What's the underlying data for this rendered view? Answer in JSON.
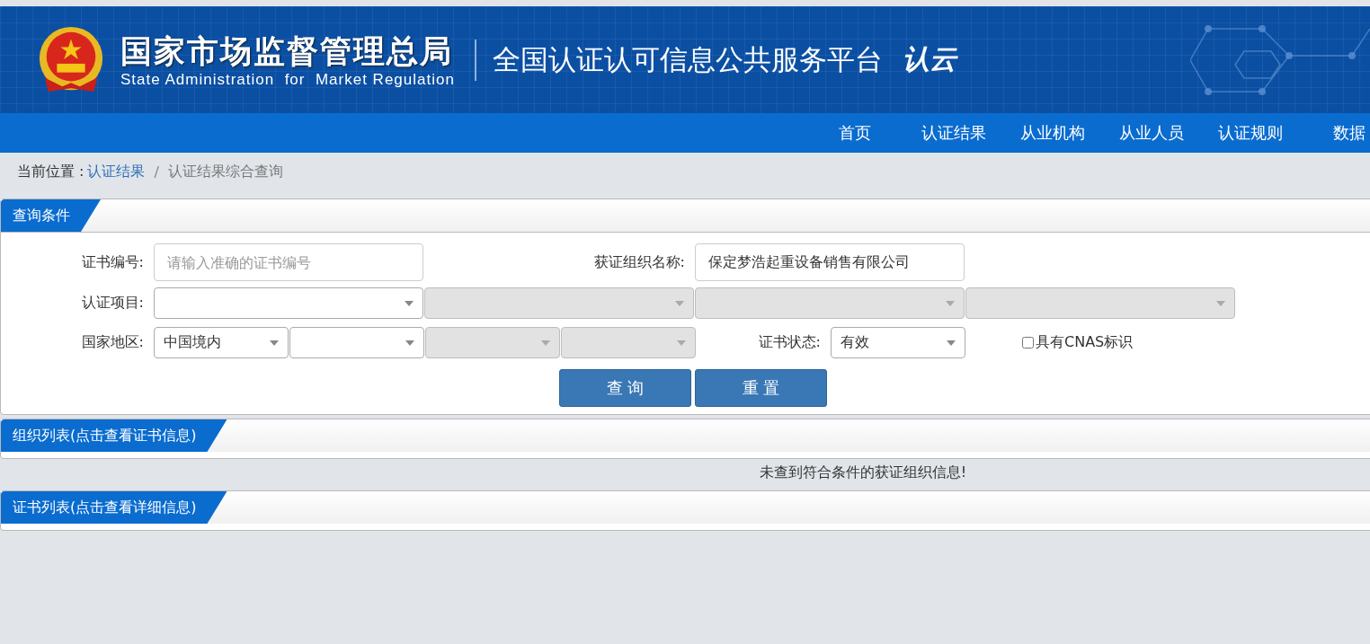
{
  "header": {
    "agency_cn": "国家市场监督管理总局",
    "agency_en": "State Administration  for  Market Regulation",
    "platform": "全国认证认可信息公共服务平台",
    "logo_text": "认云"
  },
  "nav": [
    {
      "label": "首页"
    },
    {
      "label": "认证结果"
    },
    {
      "label": "从业机构"
    },
    {
      "label": "从业人员"
    },
    {
      "label": "认证规则"
    },
    {
      "label": "数据"
    }
  ],
  "breadcrumb": {
    "prefix": "当前位置 :",
    "link": "认证结果",
    "separator": "/",
    "current": "认证结果综合查询"
  },
  "query_panel": {
    "title": "查询条件",
    "cert_no": {
      "label": "证书编号:",
      "placeholder": "请输入准确的证书编号"
    },
    "org_name": {
      "label": "获证组织名称:",
      "value": "保定梦浩起重设备销售有限公司"
    },
    "cert_project": {
      "label": "认证项目:",
      "selects": [
        {
          "disabled": false
        },
        {
          "disabled": true
        },
        {
          "disabled": true
        },
        {
          "disabled": true
        }
      ]
    },
    "region": {
      "label": "国家地区:",
      "selects": [
        {
          "value": "中国境内",
          "disabled": false
        },
        {
          "disabled": false
        },
        {
          "disabled": true
        },
        {
          "disabled": true
        }
      ]
    },
    "cert_status": {
      "label": "证书状态:",
      "value": "有效"
    },
    "cnas": {
      "label": "具有CNAS标识",
      "checked": false
    },
    "buttons": [
      "查 询",
      "重 置"
    ]
  },
  "org_panel": {
    "title": "组织列表(点击查看证书信息)",
    "message": "未查到符合条件的获证组织信息!"
  },
  "cert_panel": {
    "title": "证书列表(点击查看详细信息)"
  }
}
